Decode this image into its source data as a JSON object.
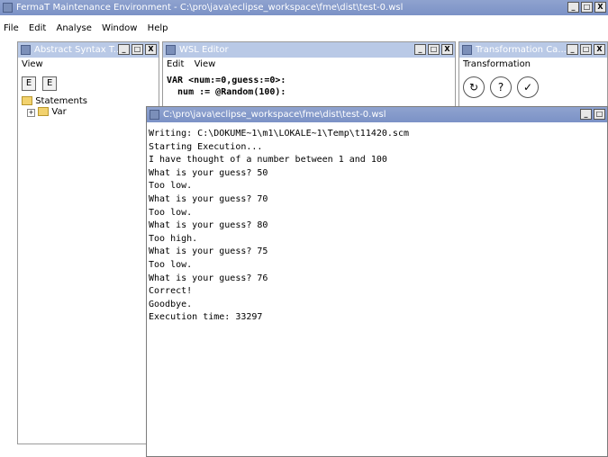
{
  "main_window": {
    "title": "FermaT Maintenance Environment - C:\\pro\\java\\eclipse_workspace\\fme\\dist\\test-0.wsl",
    "menu": [
      "File",
      "Edit",
      "Analyse",
      "Window",
      "Help"
    ]
  },
  "ast_panel": {
    "title": "Abstract Syntax T...",
    "menu": [
      "View"
    ],
    "tree": {
      "root": "Statements",
      "child": "Var"
    }
  },
  "wsl_editor": {
    "title": "WSL Editor",
    "menu": [
      "Edit",
      "View"
    ],
    "lines": [
      "VAR <num:=0,guess:=0>:",
      "  num := @Random(100):"
    ]
  },
  "transform_panel": {
    "title": "Transformation Ca...",
    "menu": [
      "Transformation"
    ]
  },
  "output_window": {
    "title": "C:\\pro\\java\\eclipse_workspace\\fme\\dist\\test-0.wsl",
    "lines": [
      "Writing: C:\\DOKUME~1\\m1\\LOKALE~1\\Temp\\t11420.scm",
      "Starting Execution...",
      "",
      "I have thought of a number between 1 and 100",
      "What is your guess? 50",
      "Too low.",
      "What is your guess? 70",
      "Too low.",
      "What is your guess? 80",
      "Too high.",
      "What is your guess? 75",
      "Too low.",
      "What is your guess? 76",
      "Correct!",
      "Goodbye.",
      "",
      "Execution time: 33297"
    ]
  },
  "window_buttons": {
    "minimize": "_",
    "maximize": "□",
    "close": "X"
  }
}
